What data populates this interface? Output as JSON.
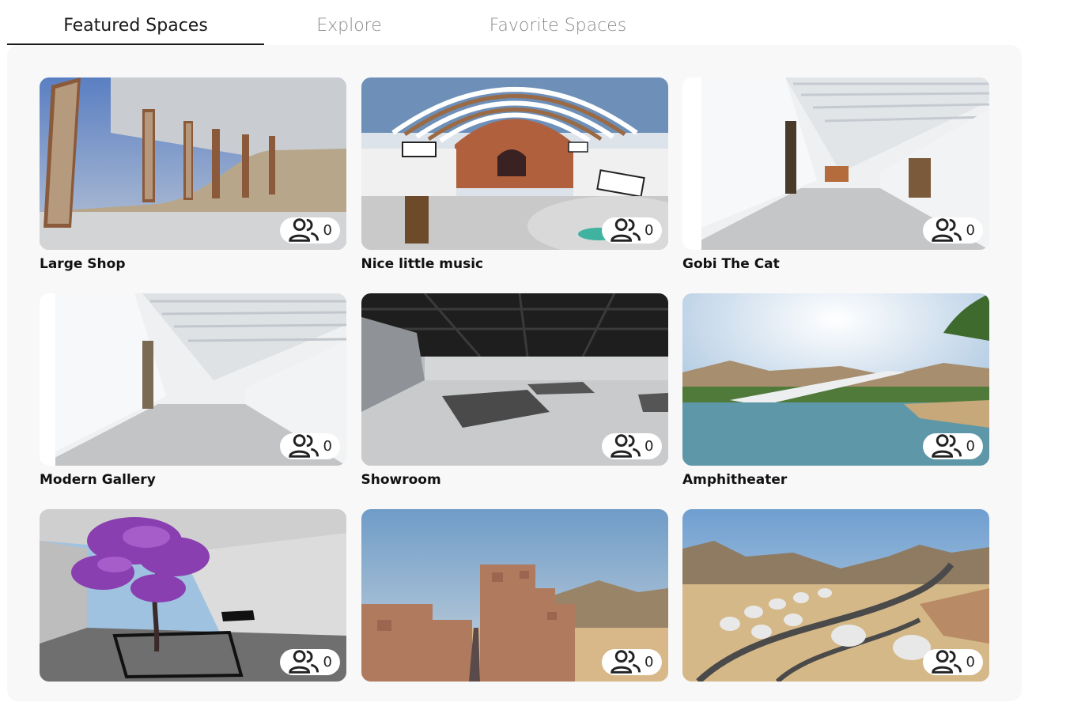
{
  "tabs": [
    {
      "label": "Featured Spaces",
      "active": true
    },
    {
      "label": "Explore",
      "active": false
    },
    {
      "label": "Favorite Spaces",
      "active": false
    }
  ],
  "spaces": [
    {
      "title": "Large Shop",
      "users": "0",
      "scene": "desert-screens"
    },
    {
      "title": "Nice little music",
      "users": "0",
      "scene": "arched-hall"
    },
    {
      "title": "Gobi The Cat",
      "users": "0",
      "scene": "white-gallery"
    },
    {
      "title": "Modern Gallery",
      "users": "0",
      "scene": "white-gallery"
    },
    {
      "title": "Showroom",
      "users": "0",
      "scene": "dark-showroom"
    },
    {
      "title": "Amphitheater",
      "users": "0",
      "scene": "oasis-lake"
    },
    {
      "title": "",
      "users": "0",
      "scene": "purple-tree-courtyard"
    },
    {
      "title": "",
      "users": "0",
      "scene": "adobe-village"
    },
    {
      "title": "",
      "users": "0",
      "scene": "desert-domes"
    }
  ],
  "icons": {
    "users": "users-icon"
  },
  "colors": {
    "panel": "#f8f8f8",
    "active_tab": "#1a1a1a",
    "inactive_tab": "#8a8a8a"
  }
}
